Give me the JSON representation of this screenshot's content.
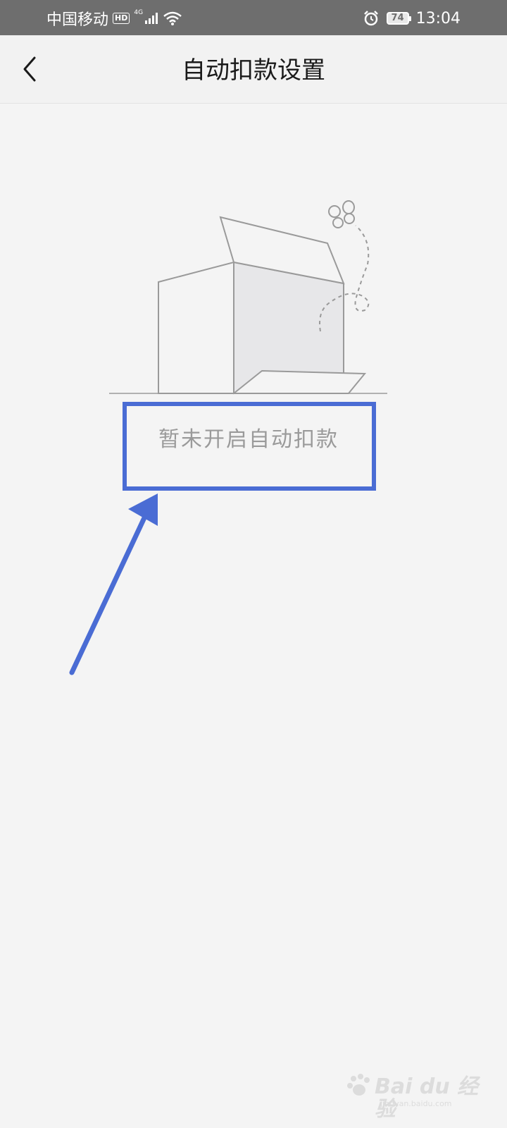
{
  "status_bar": {
    "carrier": "中国移动",
    "hd_label": "HD",
    "network_type": "4G",
    "battery_level": "74",
    "time": "13:04"
  },
  "header": {
    "title": "自动扣款设置",
    "back_icon": "chevron-left-icon"
  },
  "empty_state": {
    "message": "暂未开启自动扣款",
    "illustration": "empty-box-illustration"
  },
  "annotation": {
    "highlight_color": "#4a6cd4"
  },
  "watermark": {
    "text": "Bai du 经验",
    "subtext": "jingyan.baidu.com"
  }
}
